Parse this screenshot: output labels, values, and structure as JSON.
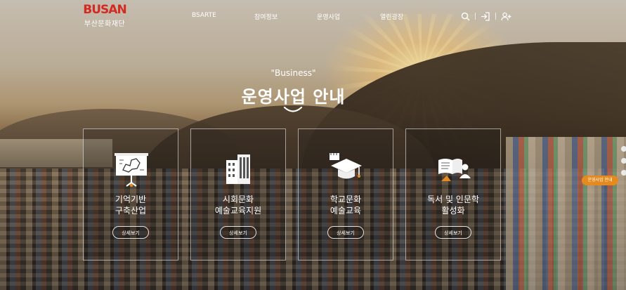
{
  "logo": {
    "mark": "BUSAN",
    "name": "부산문화재단"
  },
  "nav": {
    "items": [
      {
        "label": "BSARTE"
      },
      {
        "label": "참여정보"
      },
      {
        "label": "운영사업"
      },
      {
        "label": "열린광장"
      }
    ]
  },
  "utils": {
    "search_icon": "search-icon",
    "login_icon": "login-icon",
    "user_add_icon": "user-add-icon"
  },
  "hero": {
    "eyebrow": "\"Business\"",
    "title": "운영사업 안내"
  },
  "cards": [
    {
      "icon": "map-board-icon",
      "line1": "기억기반",
      "line2": "구축산업",
      "button": "상세보기"
    },
    {
      "icon": "building-icon",
      "line1": "시회문화",
      "line2": "예술교육지원",
      "button": "상세보기"
    },
    {
      "icon": "graduation-cap-icon",
      "line1": "학교문화",
      "line2": "예술교육",
      "button": "상세보기"
    },
    {
      "icon": "reading-person-icon",
      "line1": "독서 및 인문학",
      "line2": "활성화",
      "button": "상세보기"
    }
  ],
  "side_badge": {
    "label": "운영사업 안내"
  },
  "colors": {
    "brand_red": "#d32a22",
    "badge_orange": "#e58a1f"
  }
}
